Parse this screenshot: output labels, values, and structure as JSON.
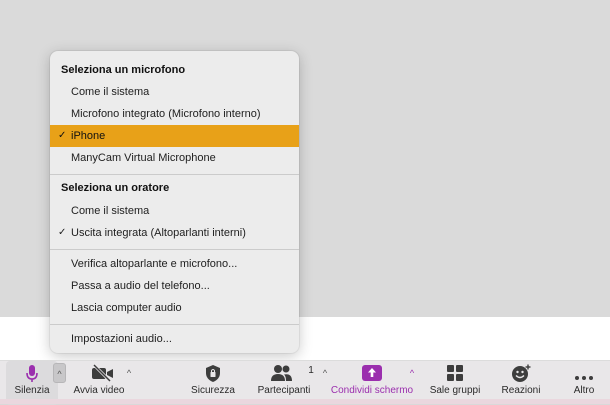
{
  "menu": {
    "mic_section": {
      "header": "Seleziona un microfono",
      "items": [
        {
          "label": "Come il sistema",
          "checked": false,
          "selected": false
        },
        {
          "label": "Microfono integrato (Microfono interno)",
          "checked": false,
          "selected": false
        },
        {
          "label": "iPhone",
          "checked": true,
          "selected": true
        },
        {
          "label": "ManyCam Virtual Microphone",
          "checked": false,
          "selected": false
        }
      ]
    },
    "speaker_section": {
      "header": "Seleziona un oratore",
      "items": [
        {
          "label": "Come il sistema",
          "checked": false
        },
        {
          "label": "Uscita integrata (Altoparlanti interni)",
          "checked": true
        }
      ]
    },
    "actions": [
      {
        "label": "Verifica altoparlante e microfono..."
      },
      {
        "label": "Passa a audio del telefono..."
      },
      {
        "label": "Lascia computer audio"
      }
    ],
    "settings_label": "Impostazioni audio...",
    "check_glyph": "✓",
    "selected_color": "#e8a118"
  },
  "toolbar": {
    "mute_label": "Silenzia",
    "video_label": "Avvia video",
    "security_label": "Sicurezza",
    "participants_label": "Partecipanti",
    "participants_count": "1",
    "share_label": "Condividi schermo",
    "breakout_label": "Sale gruppi",
    "reactions_label": "Reazioni",
    "more_label": "Altro",
    "caret_glyph": "^",
    "accent_color": "#9b2fae"
  }
}
